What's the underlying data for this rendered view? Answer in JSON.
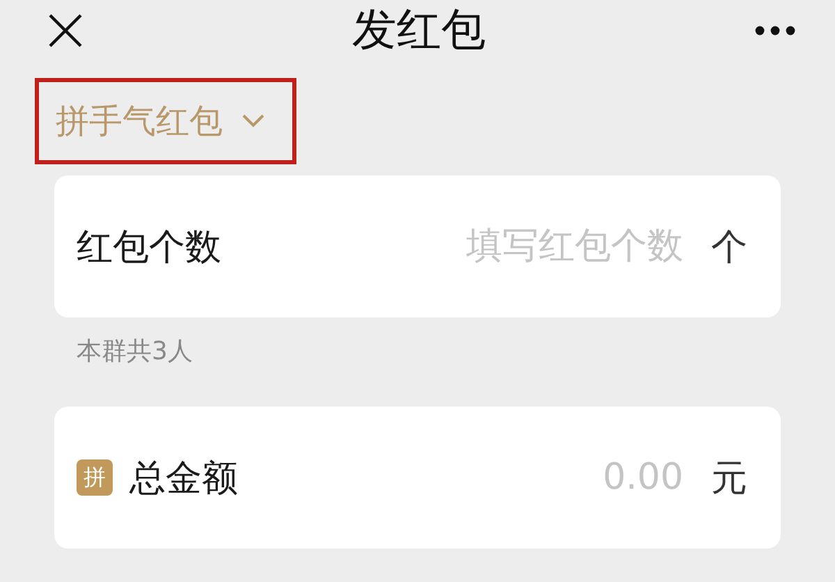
{
  "header": {
    "title": "发红包"
  },
  "packet_type": {
    "label": "拼手气红包",
    "highlighted": true
  },
  "count_row": {
    "label": "红包个数",
    "placeholder": "填写红包个数",
    "unit": "个"
  },
  "group_note": "本群共3人",
  "amount_row": {
    "badge": "拼",
    "label": "总金额",
    "placeholder": "0.00",
    "unit": "元"
  }
}
